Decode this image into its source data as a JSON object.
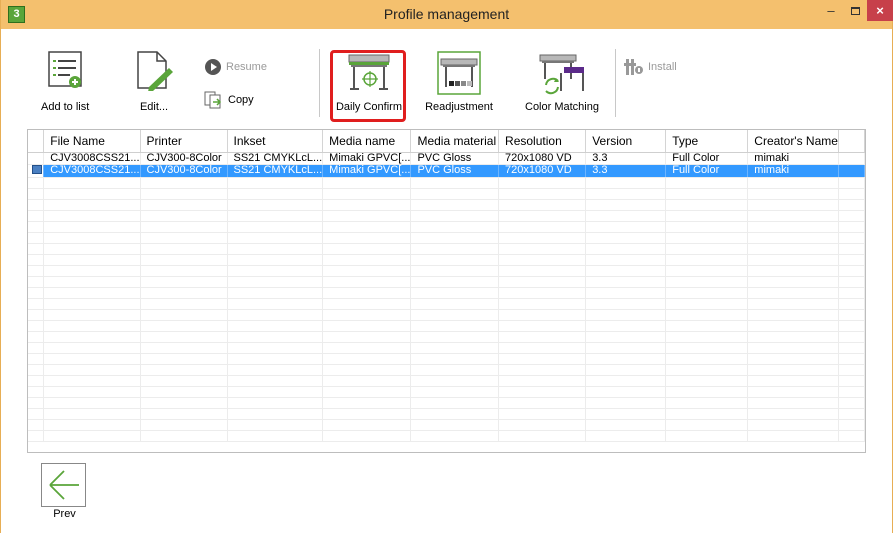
{
  "window": {
    "title": "Profile management",
    "controls": {
      "minimize": "–",
      "maximize": "",
      "close": "×"
    }
  },
  "app_icon": "3",
  "toolbar": {
    "add_to_list": "Add to list",
    "edit": "Edit...",
    "resume": "Resume",
    "copy": "Copy",
    "daily_confirm": "Daily Confirm",
    "readjustment": "Readjustment",
    "color_matching": "Color Matching",
    "install": "Install"
  },
  "table": {
    "columns": [
      "File Name",
      "Printer",
      "Inkset",
      "Media name",
      "Media material",
      "Resolution",
      "Version",
      "Type",
      "Creator's Name"
    ],
    "rows": [
      [
        "CJV3008CSS21...",
        "CJV300-8Color",
        "SS21 CMYKLcL...",
        "Mimaki GPVC[...",
        "PVC Gloss",
        "720x1080 VD",
        "3.3",
        "Full Color",
        "mimaki"
      ],
      [
        "CJV3008CSS21...",
        "CJV300-8Color",
        "SS21 CMYKLcL...",
        "Mimaki GPVC[...",
        "PVC Gloss",
        "720x1080 VD",
        "3.3",
        "Full Color",
        "mimaki"
      ]
    ],
    "selected_row": 2
  },
  "footer": {
    "prev": "Prev"
  },
  "colors": {
    "titlebar": "#f4c06e",
    "selection": "#3399ff",
    "highlight": "#e01e1e",
    "accent_green": "#5aa53a"
  }
}
